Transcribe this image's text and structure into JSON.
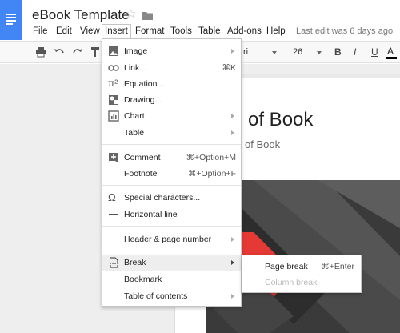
{
  "doc": {
    "title": "eBook Template",
    "last_edit": "Last edit was 6 days ago"
  },
  "menubar": [
    {
      "label": "File"
    },
    {
      "label": "Edit"
    },
    {
      "label": "View"
    },
    {
      "label": "Insert",
      "active": true
    },
    {
      "label": "Format"
    },
    {
      "label": "Tools"
    },
    {
      "label": "Table"
    },
    {
      "label": "Add-ons"
    },
    {
      "label": "Help"
    }
  ],
  "toolbar": {
    "font_name": "ri",
    "font_size": "26",
    "bold": "B",
    "italic": "I",
    "underline": "U",
    "text_color": "A"
  },
  "page": {
    "title_fragment": "of Book",
    "subtitle_fragment": "of Book"
  },
  "insert_menu": {
    "items": [
      {
        "label": "Image",
        "icon": "image-icon",
        "submenu": true
      },
      {
        "label": "Link...",
        "icon": "link-icon",
        "shortcut": "⌘K"
      },
      {
        "label": "Equation...",
        "icon": "pi-icon"
      },
      {
        "label": "Drawing...",
        "icon": "drawing-icon"
      },
      {
        "label": "Chart",
        "icon": "chart-icon",
        "submenu": true
      },
      {
        "label": "Table",
        "submenu": true
      },
      {
        "label": "Comment",
        "icon": "comment-icon",
        "shortcut": "⌘+Option+M"
      },
      {
        "label": "Footnote",
        "shortcut": "⌘+Option+F"
      },
      {
        "label": "Special characters...",
        "icon": "omega-icon"
      },
      {
        "label": "Horizontal line",
        "icon": "horizontal-line-icon"
      },
      {
        "label": "Header & page number",
        "submenu": true
      },
      {
        "label": "Break",
        "icon": "page-break-icon",
        "submenu": true,
        "highlighted": true
      },
      {
        "label": "Bookmark"
      },
      {
        "label": "Table of contents",
        "submenu": true
      }
    ]
  },
  "break_submenu": {
    "items": [
      {
        "label": "Page break",
        "shortcut": "⌘+Enter"
      },
      {
        "label": "Column break",
        "disabled": true
      }
    ]
  },
  "colors": {
    "brand_blue": "#4285f4",
    "menu_highlight": "#eeeeee",
    "cover_red": "#e53935"
  }
}
